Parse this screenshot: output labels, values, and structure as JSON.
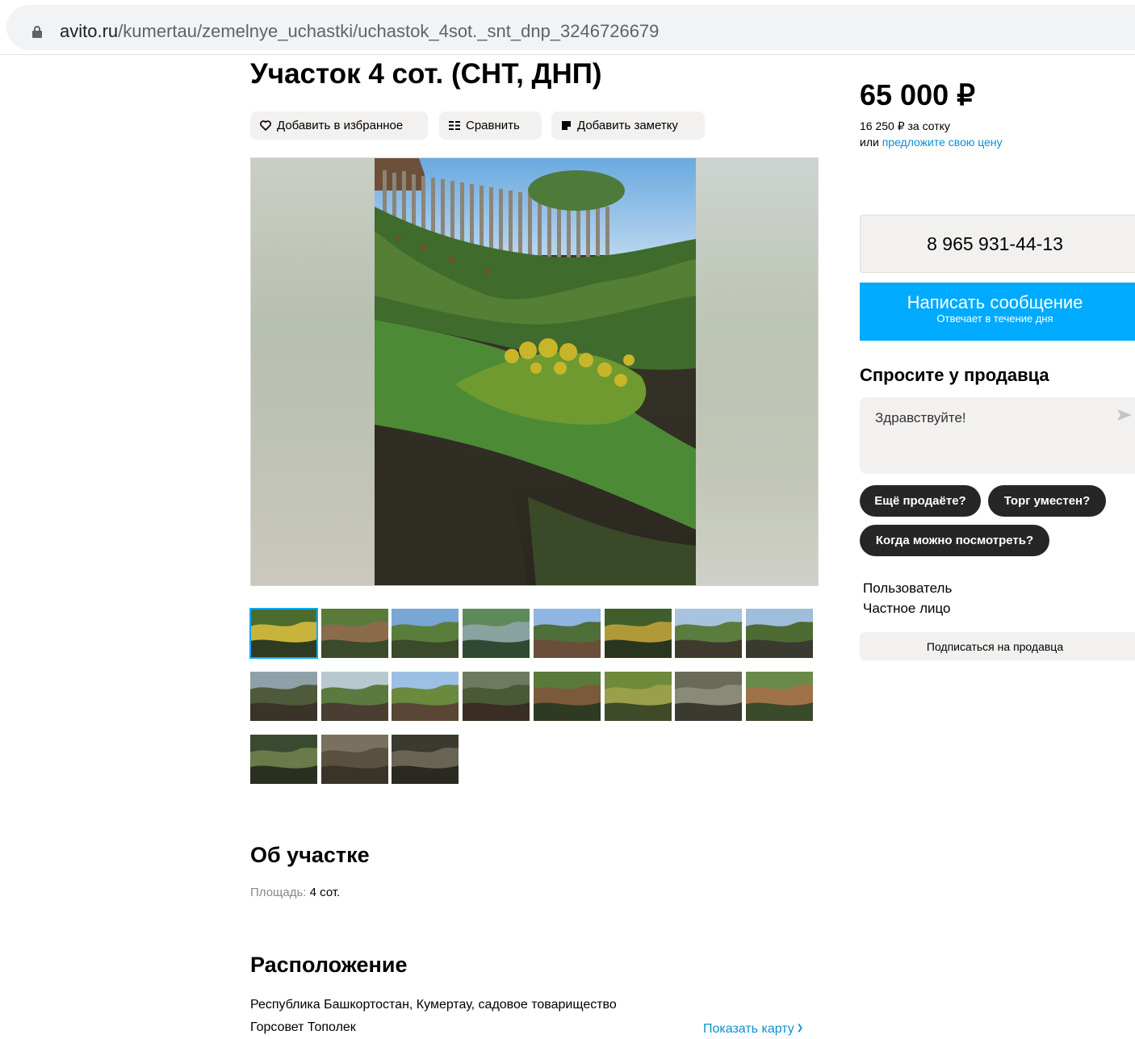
{
  "browser": {
    "url_host": "avito.ru",
    "url_path": "/kumertau/zemelnye_uchastki/uchastok_4sot._snt_dnp_3246726679"
  },
  "listing": {
    "title": "Участок 4 сот. (СНТ, ДНП)",
    "actions": {
      "favorite": "Добавить в избранное",
      "compare": "Сравнить",
      "note": "Добавить заметку"
    },
    "thumbnail_count": 19,
    "active_thumbnail": 1
  },
  "price": {
    "value": "65 000 ₽",
    "per_sotka": "16 250 ₽ за сотку",
    "offer_prefix": "или ",
    "offer_link": "предложите свою цену"
  },
  "contact": {
    "phone": "8 965 931-44-13",
    "message_label": "Написать сообщение",
    "message_sub": "Отвечает в течение дня"
  },
  "ask": {
    "title": "Спросите у продавца",
    "input_value": "Здравствуйте!",
    "chips": [
      "Ещё продаёте?",
      "Торг уместен?",
      "Когда можно посмотреть?"
    ]
  },
  "seller": {
    "name": "Пользователь",
    "type": "Частное лицо",
    "subscribe": "Подписаться на продавца"
  },
  "about": {
    "title": "Об участке",
    "area_label": "Площадь:",
    "area_value": " 4 сот."
  },
  "location": {
    "title": "Расположение",
    "address_line1": "Республика Башкортостан, Кумертау, садовое товарищество",
    "address_line2": "Горсовет Тополек",
    "show_map": "Показать карту"
  },
  "colors": {
    "accent": "#00aaff",
    "link": "#0a8fd6",
    "chip_bg": "#262626",
    "button_bg": "#f2f1f0"
  }
}
